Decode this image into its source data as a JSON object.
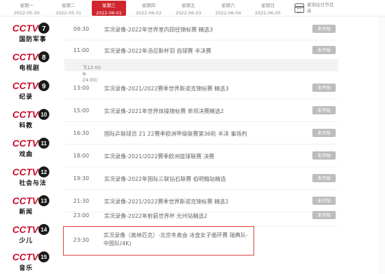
{
  "dates": [
    {
      "weekday": "星期一",
      "date": "2022-05-30"
    },
    {
      "weekday": "星期二",
      "date": "2022-05-31"
    },
    {
      "weekday": "星期三",
      "date": "2022-06-01"
    },
    {
      "weekday": "星期四",
      "date": "2022-06-02"
    },
    {
      "weekday": "星期五",
      "date": "2022-06-03"
    },
    {
      "weekday": "星期六",
      "date": "2022-06-04"
    },
    {
      "weekday": "星期日",
      "date": "2022-06-05"
    }
  ],
  "calendar": {
    "label": "查询往日节目单"
  },
  "channels": [
    {
      "logo": "CCTV",
      "num": "7",
      "name": "国防军事"
    },
    {
      "logo": "CCTV",
      "num": "8",
      "name": "电视剧"
    },
    {
      "logo": "CCTV",
      "num": "9",
      "name": "纪录"
    },
    {
      "logo": "CCTV",
      "num": "10",
      "name": "科教"
    },
    {
      "logo": "CCTV",
      "num": "11",
      "name": "戏曲"
    },
    {
      "logo": "CCTV",
      "num": "12",
      "name": "社会与法"
    },
    {
      "logo": "CCTV",
      "num": "13",
      "name": "新闻"
    },
    {
      "logo": "CCTV",
      "num": "14",
      "name": "少儿"
    },
    {
      "logo": "CCTV",
      "num": "15",
      "name": "音乐"
    }
  ],
  "period": {
    "label": "下午",
    "range": "（12:00 - 24:00）"
  },
  "programs": [
    {
      "time": "09:30",
      "title": "实况录像-2022年世界室内田径锦标赛 精选3",
      "status": "未开始"
    },
    {
      "time": "11:00",
      "title": "实况录像-2022年汤尼斯杯羽 自球赛 半决赛",
      "status": "未开始"
    },
    {
      "time": "13:00",
      "title": "实况录像-2021/2022赛季世界斯诺克锦标赛 精选3",
      "status": "未开始"
    },
    {
      "time": "15:00",
      "title": "实况录像-2021年世界体操锦标赛 单项决赛精选2",
      "status": "未开始"
    },
    {
      "time": "16:30",
      "title": "国际乒联球员 21 22赛季欧洲甲级联赛第36轮 半决 事场判",
      "status": "未开始"
    },
    {
      "time": "18:00",
      "title": "实况录像-2021/2022赛季欧洲篮球联赛 决赛",
      "status": "未开始"
    },
    {
      "time": "19:30",
      "title": "实况录像-2022年国际三联钻石联赛 伯明翰站精选",
      "status": "未开始"
    },
    {
      "time": "21:30",
      "title": "实况录像-2021/2022赛季世界斯诺克锦标赛 精选1",
      "status": "未开始"
    },
    {
      "time": "23:00",
      "title": "实况录像-2022年射箭世界杯 光州站精选2",
      "status": "未开始"
    }
  ],
  "highlight": {
    "time": "23:30",
    "title": "实况录像（奥林匹克）-北京冬奥会 冰壶女子循环赛 瑞典队-中国队(4K)"
  }
}
